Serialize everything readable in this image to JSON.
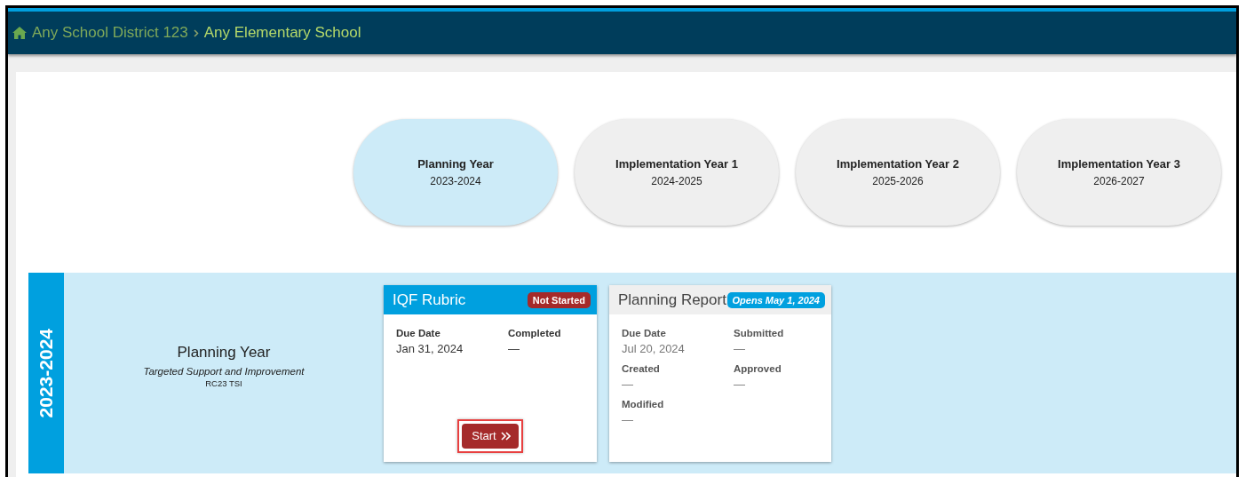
{
  "breadcrumb": [
    {
      "label": "Any School District 123",
      "current": false
    },
    {
      "label": "Any Elementary School",
      "current": true
    }
  ],
  "phases": [
    {
      "title": "Planning Year",
      "years": "2023-2024",
      "selected": true
    },
    {
      "title": "Implementation Year 1",
      "years": "2024-2025",
      "selected": false
    },
    {
      "title": "Implementation Year 2",
      "years": "2025-2026",
      "selected": false
    },
    {
      "title": "Implementation Year 3",
      "years": "2026-2027",
      "selected": false
    }
  ],
  "year_section": {
    "label": "2023-2024",
    "title": "Planning Year",
    "subtitle": "Targeted Support and Improvement",
    "code": "RC23 TSI",
    "cards": [
      {
        "title": "IQF Rubric",
        "active": true,
        "badge": {
          "text": "Not Started",
          "kind": "status"
        },
        "fields": [
          {
            "label": "Due Date",
            "value": "Jan 31, 2024"
          },
          {
            "label": "Completed",
            "value": "—"
          }
        ],
        "button": {
          "label": "Start",
          "highlighted": true
        }
      },
      {
        "title": "Planning Report",
        "active": false,
        "badge": {
          "text": "Opens May 1, 2024",
          "kind": "opens"
        },
        "fields": [
          {
            "label": "Due Date",
            "value": "Jul 20, 2024"
          },
          {
            "label": "Submitted",
            "value": "—"
          },
          {
            "label": "Created",
            "value": "—"
          },
          {
            "label": "Approved",
            "value": "—"
          },
          {
            "label": "Modified",
            "value": "—"
          }
        ]
      }
    ]
  }
}
